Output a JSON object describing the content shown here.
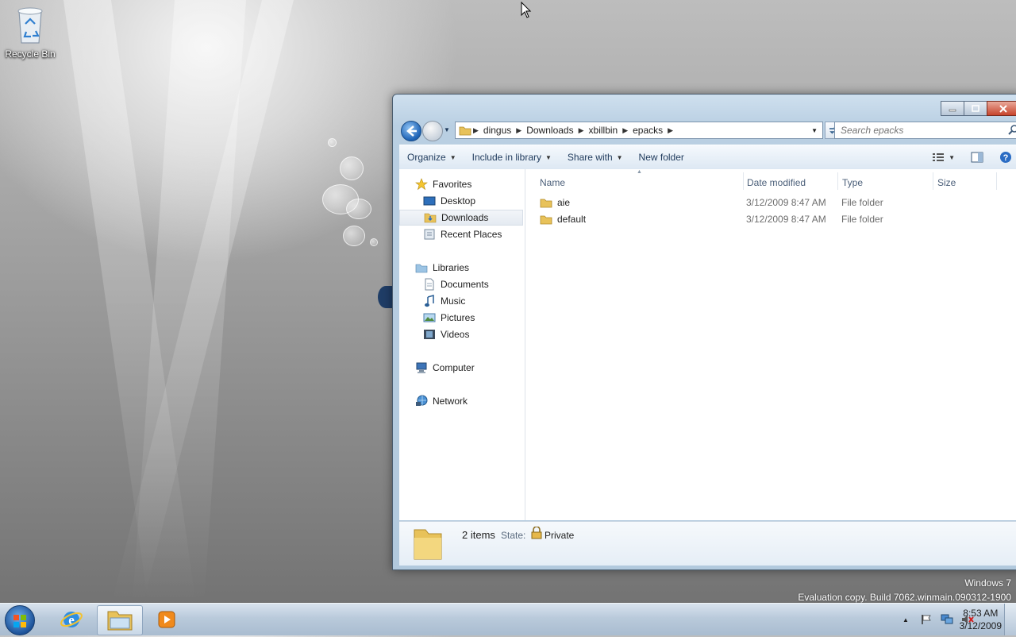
{
  "desktop": {
    "recycle_bin_label": "Recycle Bin",
    "watermark_line1": "Windows 7",
    "watermark_line2": "Evaluation copy. Build 7062.winmain.090312-1900"
  },
  "explorer": {
    "breadcrumbs": [
      "dingus",
      "Downloads",
      "xbillbin",
      "epacks"
    ],
    "search_placeholder": "Search epacks",
    "toolbar": {
      "organize": "Organize",
      "include_in_library": "Include in library",
      "share_with": "Share with",
      "new_folder": "New folder"
    },
    "nav": {
      "favorites": "Favorites",
      "desktop": "Desktop",
      "downloads": "Downloads",
      "recent_places": "Recent Places",
      "libraries": "Libraries",
      "documents": "Documents",
      "music": "Music",
      "pictures": "Pictures",
      "videos": "Videos",
      "computer": "Computer",
      "network": "Network"
    },
    "columns": {
      "name": "Name",
      "date_modified": "Date modified",
      "type": "Type",
      "size": "Size"
    },
    "files": [
      {
        "name": "aie",
        "date": "3/12/2009 8:47 AM",
        "type": "File folder"
      },
      {
        "name": "default",
        "date": "3/12/2009 8:47 AM",
        "type": "File folder"
      }
    ],
    "details": {
      "count": "2 items",
      "state_label": "State:",
      "state_value": "Private"
    }
  },
  "taskbar": {
    "time": "8:53 AM",
    "date": "3/12/2009"
  },
  "colors": {
    "folder": "#e8c25a",
    "accent": "#1d62b5"
  }
}
